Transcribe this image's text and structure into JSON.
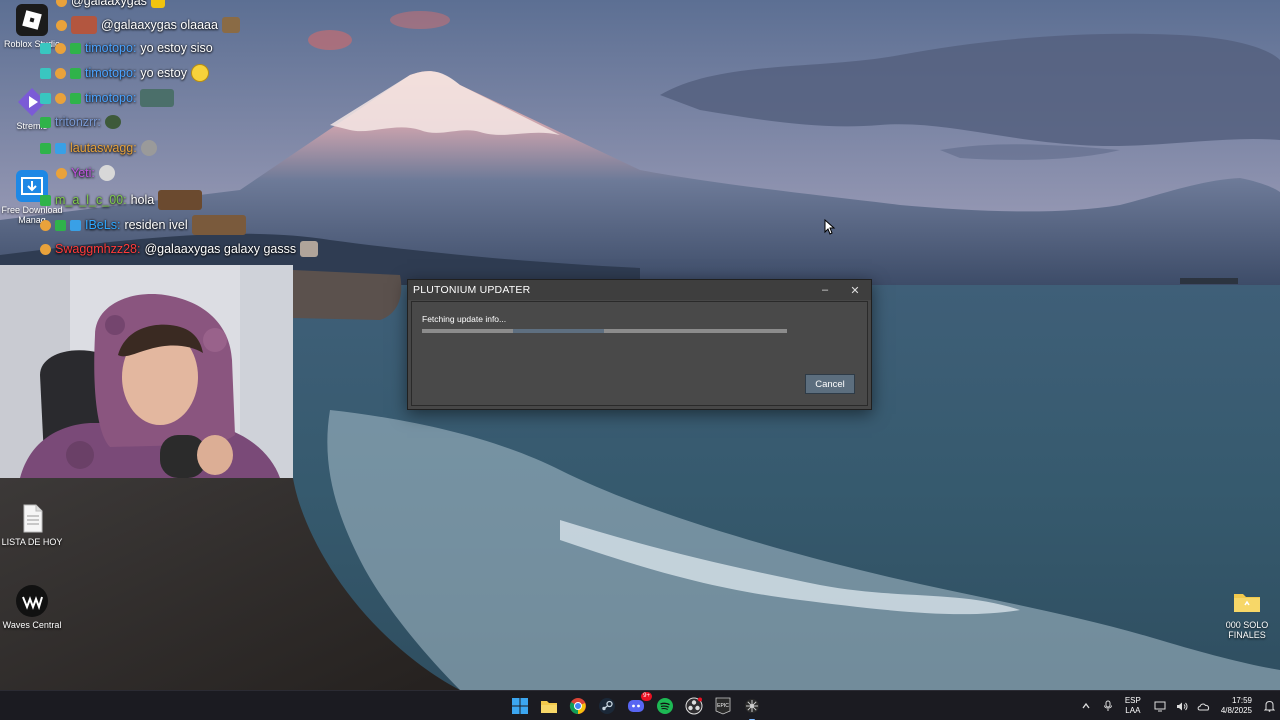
{
  "desktop_icons": [
    {
      "name": "roblox",
      "label": "Roblox Studio",
      "color": "#1b1b1b"
    },
    {
      "name": "stremio",
      "label": "Stremio",
      "color": "#7b5bd6"
    },
    {
      "name": "free-download-manager",
      "label": "Free Download Manag",
      "color": "#1e88e5"
    },
    {
      "name": "lista-de-hoy",
      "label": "LISTA DE HOY",
      "color": "#ffffff"
    },
    {
      "name": "waves-central",
      "label": "Waves Central",
      "color": "#111111"
    },
    {
      "name": "000-solo-finales",
      "label": "000 SOLO FINALES",
      "color": "#f2c94c"
    }
  ],
  "chat": [
    {
      "user": "@galaaxygas",
      "text": "",
      "user_color": "#ffffff"
    },
    {
      "user": "",
      "text": "@galaaxygas olaaaa",
      "user_color": "#ffffff"
    },
    {
      "user": "timotopo:",
      "text": "yo estoy siso",
      "user_color": "#4aa3ff"
    },
    {
      "user": "timotopo:",
      "text": "yo estoy",
      "user_color": "#4aa3ff"
    },
    {
      "user": "timotopo:",
      "text": "",
      "user_color": "#4aa3ff"
    },
    {
      "user": "tritonzrr:",
      "text": "",
      "user_color": "#7a9bd6"
    },
    {
      "user": "lautaswagg:",
      "text": "",
      "user_color": "#e6a23c"
    },
    {
      "user": "Yeti:",
      "text": "",
      "user_color": "#c054e0"
    },
    {
      "user": "m_a_l_c_00:",
      "text": "hola",
      "user_color": "#7ecb4b"
    },
    {
      "user": "IBeLs:",
      "text": "residen ivel",
      "user_color": "#2fa8ff"
    },
    {
      "user": "Swaggmhzz28:",
      "text": "@galaaxygas galaxy gasss",
      "user_color": "#ff3b3b"
    }
  ],
  "dialog": {
    "title": "PLUTONIUM UPDATER",
    "status": "Fetching update info...",
    "progress": 0.48,
    "cancel_label": "Cancel",
    "minimize_glyph": "–",
    "close_glyph": "✕"
  },
  "taskbar": {
    "apps": [
      "start",
      "file-explorer",
      "chrome",
      "steam",
      "discord",
      "spotify",
      "obs",
      "epic-games",
      "plutonium"
    ],
    "discord_badge": "9+",
    "lang_top": "ESP",
    "lang_bottom": "LAA",
    "time": "17:59",
    "date": "4/8/2025"
  }
}
